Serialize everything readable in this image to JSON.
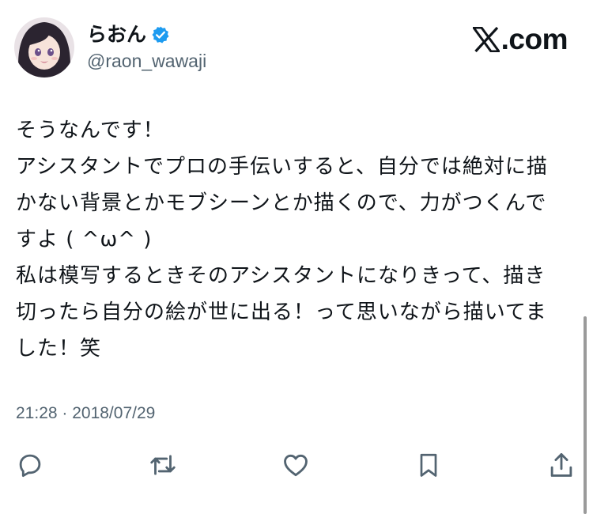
{
  "header": {
    "display_name": "らおん",
    "handle": "@raon_wawaji",
    "brand": ".com"
  },
  "tweet": {
    "lines": [
      "そうなんです！",
      "アシスタントでプロの手伝いすると、自分では絶対に描",
      "かない背景とかモブシーンとか描くので、力がつくんで",
      "すよ ( ^ω^ )",
      "私は模写するときそのアシスタントになりきって、描き",
      "切ったら自分の絵が世に出る！って思いながら描いてま",
      "した！笑"
    ],
    "timestamp": "21:28 · 2018/07/29"
  },
  "icons": {
    "verified": "verified-badge-icon",
    "brand_logo": "x-logo-icon",
    "reply": "reply-icon",
    "retweet": "retweet-icon",
    "like": "heart-icon",
    "bookmark": "bookmark-icon",
    "share": "share-icon"
  },
  "colors": {
    "text": "#0f1419",
    "secondary": "#536471",
    "verified": "#1d9bf0",
    "background": "#ffffff"
  }
}
